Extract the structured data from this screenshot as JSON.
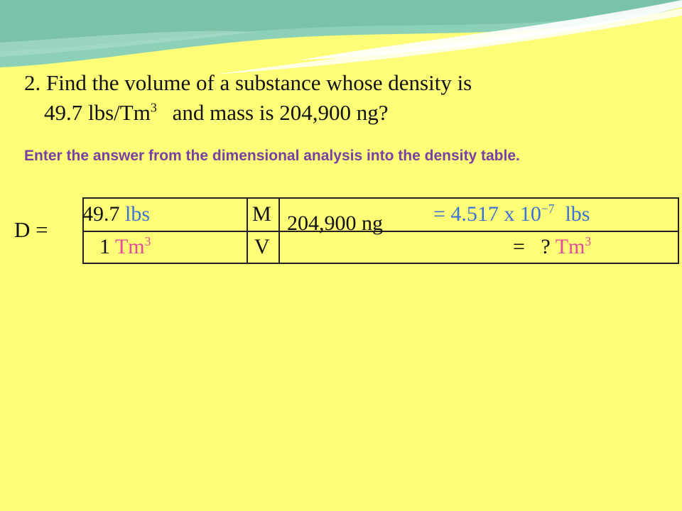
{
  "colors": {
    "background": "#FDFD78",
    "question_text": "#111111",
    "instruction_text": "#7A3FA3",
    "unit_blue": "#3B73D6",
    "unit_pink": "#E84A9A"
  },
  "question": {
    "line1": "2. Find the volume of a substance whose density is",
    "line2_value": "49.7 lbs/Tm",
    "line2_exp": "3",
    "line2_rest": "and mass is 204,900 ng?"
  },
  "instruction": "Enter the answer from the dimensional analysis into the density table.",
  "table": {
    "d_label": "D =",
    "density_num_value": "49.7",
    "density_num_unit": "lbs",
    "density_den_value": "1",
    "density_den_unit": "Tm",
    "density_den_exp": "3",
    "m_label": "M",
    "v_label": "V",
    "mass_given": "204,900 ng",
    "mass_result_prefix": "= 4.517 x 10",
    "mass_result_exp": "−7",
    "mass_result_unit": "lbs",
    "volume_result_prefix": "=   ?",
    "volume_result_unit": "Tm",
    "volume_result_exp": "3"
  }
}
